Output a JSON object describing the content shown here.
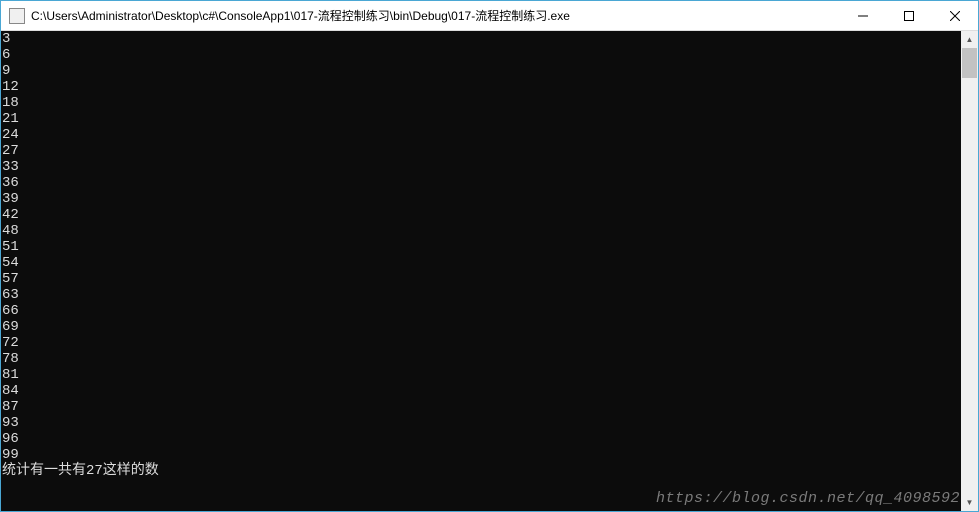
{
  "window": {
    "title": "C:\\Users\\Administrator\\Desktop\\c#\\ConsoleApp1\\017-流程控制练习\\bin\\Debug\\017-流程控制练习.exe"
  },
  "console": {
    "lines": [
      "3",
      "6",
      "9",
      "12",
      "18",
      "21",
      "24",
      "27",
      "33",
      "36",
      "39",
      "42",
      "48",
      "51",
      "54",
      "57",
      "63",
      "66",
      "69",
      "72",
      "78",
      "81",
      "84",
      "87",
      "93",
      "96",
      "99"
    ],
    "summary": "统计有一共有27这样的数"
  },
  "watermark": "https://blog.csdn.net/qq_4098592"
}
